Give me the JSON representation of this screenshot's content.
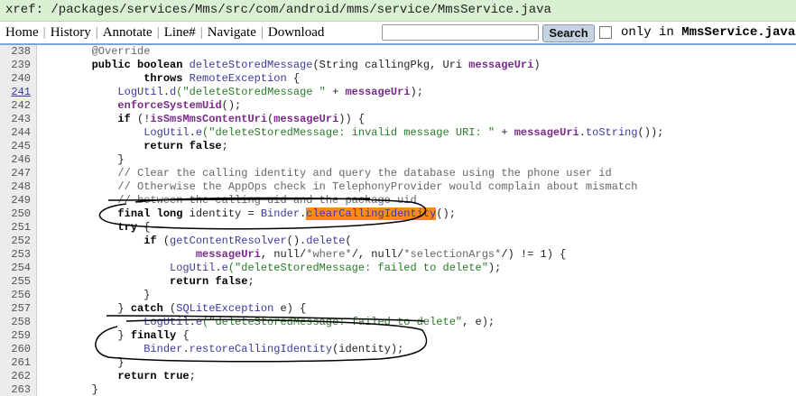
{
  "xref_path": "xref: /packages/services/Mms/src/com/android/mms/service/MmsService.java",
  "nav": {
    "items": [
      "Home",
      "History",
      "Annotate",
      "Line#",
      "Navigate",
      "Download"
    ],
    "search_value": "",
    "search_button": "Search",
    "only_in_prefix": "only in ",
    "only_in_file": "MmsService.java"
  },
  "code": {
    "lines": [
      {
        "n": "238",
        "link": false,
        "t": [
          [
            "cm",
            "        @Override"
          ]
        ]
      },
      {
        "n": "239",
        "link": false,
        "t": [
          [
            "kw",
            "        public boolean "
          ],
          [
            "fn",
            "deleteStoredMessage"
          ],
          [
            "",
            "(String callingPkg, Uri "
          ],
          [
            "id",
            "messageUri"
          ],
          [
            "",
            ")"
          ]
        ]
      },
      {
        "n": "240",
        "link": false,
        "t": [
          [
            "kw",
            "                throws "
          ],
          [
            "ty",
            "RemoteException"
          ],
          [
            "",
            " {"
          ]
        ]
      },
      {
        "n": "241",
        "link": true,
        "t": [
          [
            "",
            "            "
          ],
          [
            "ty",
            "LogUtil"
          ],
          [
            "",
            "."
          ],
          [
            "fn",
            "d"
          ],
          [
            "str",
            "(\"deleteStoredMessage \" "
          ],
          [
            "",
            "+ "
          ],
          [
            "id",
            "messageUri"
          ],
          [
            "",
            ");"
          ]
        ]
      },
      {
        "n": "242",
        "link": false,
        "t": [
          [
            "",
            "            "
          ],
          [
            "id",
            "enforceSystemUid"
          ],
          [
            "",
            "();"
          ]
        ]
      },
      {
        "n": "243",
        "link": false,
        "t": [
          [
            "kw",
            "            if "
          ],
          [
            "",
            "(!"
          ],
          [
            "id",
            "isSmsMmsContentUri"
          ],
          [
            "",
            "("
          ],
          [
            "id",
            "messageUri"
          ],
          [
            "",
            ")) {"
          ]
        ]
      },
      {
        "n": "244",
        "link": false,
        "t": [
          [
            "",
            "                "
          ],
          [
            "ty",
            "LogUtil"
          ],
          [
            "",
            "."
          ],
          [
            "fn",
            "e"
          ],
          [
            "str",
            "(\"deleteStoredMessage: invalid message URI: \" "
          ],
          [
            "",
            "+ "
          ],
          [
            "id",
            "messageUri"
          ],
          [
            "",
            "."
          ],
          [
            "fn",
            "toString"
          ],
          [
            "",
            "());"
          ]
        ]
      },
      {
        "n": "245",
        "link": false,
        "t": [
          [
            "kw",
            "                return false"
          ],
          [
            "",
            ";"
          ]
        ]
      },
      {
        "n": "246",
        "link": false,
        "t": [
          [
            "",
            "            }"
          ]
        ]
      },
      {
        "n": "247",
        "link": false,
        "t": [
          [
            "cm",
            "            // Clear the calling identity and query the database using the phone user id"
          ]
        ]
      },
      {
        "n": "248",
        "link": false,
        "t": [
          [
            "cm",
            "            // Otherwise the AppOps check in TelephonyProvider would complain about mismatch"
          ]
        ]
      },
      {
        "n": "249",
        "link": false,
        "t": [
          [
            "cm",
            "            // between the calling uid and the package uid"
          ]
        ]
      },
      {
        "n": "250",
        "link": false,
        "t": [
          [
            "kw",
            "            final long "
          ],
          [
            "",
            "identity = "
          ],
          [
            "ty",
            "Binder"
          ],
          [
            "",
            "."
          ],
          [
            "hl",
            "clearCallingIdentity"
          ],
          [
            "",
            "();"
          ]
        ]
      },
      {
        "n": "251",
        "link": false,
        "t": [
          [
            "kw",
            "            try "
          ],
          [
            "",
            "{"
          ]
        ]
      },
      {
        "n": "252",
        "link": false,
        "t": [
          [
            "kw",
            "                if "
          ],
          [
            "",
            "("
          ],
          [
            "fn",
            "getContentResolver"
          ],
          [
            "",
            "()."
          ],
          [
            "fn",
            "delete"
          ],
          [
            "",
            "("
          ]
        ]
      },
      {
        "n": "253",
        "link": false,
        "t": [
          [
            "",
            "                        "
          ],
          [
            "id",
            "messageUri"
          ],
          [
            "",
            ", null/"
          ],
          [
            "cm",
            "*where*"
          ],
          [
            "",
            "/, null/"
          ],
          [
            "cm",
            "*selectionArgs*"
          ],
          [
            "",
            "/) != 1) {"
          ]
        ]
      },
      {
        "n": "254",
        "link": false,
        "t": [
          [
            "",
            "                    "
          ],
          [
            "ty",
            "LogUtil"
          ],
          [
            "",
            "."
          ],
          [
            "fn",
            "e"
          ],
          [
            "str",
            "(\"deleteStoredMessage: failed to delete\""
          ],
          [
            "",
            ");"
          ]
        ]
      },
      {
        "n": "255",
        "link": false,
        "t": [
          [
            "kw",
            "                    return false"
          ],
          [
            "",
            ";"
          ]
        ]
      },
      {
        "n": "256",
        "link": false,
        "t": [
          [
            "",
            "                }"
          ]
        ]
      },
      {
        "n": "257",
        "link": false,
        "t": [
          [
            "",
            "            } "
          ],
          [
            "kw",
            "catch "
          ],
          [
            "",
            "("
          ],
          [
            "ty",
            "SQLiteException"
          ],
          [
            "",
            " e) {"
          ]
        ]
      },
      {
        "n": "258",
        "link": false,
        "t": [
          [
            "",
            "                "
          ],
          [
            "ty",
            "LogUtil"
          ],
          [
            "",
            "."
          ],
          [
            "fn",
            "e"
          ],
          [
            "str",
            "(\"deleteStoredMessage: failed to delete\""
          ],
          [
            "",
            ", e);"
          ]
        ]
      },
      {
        "n": "259",
        "link": false,
        "t": [
          [
            "",
            "            } "
          ],
          [
            "kw",
            "finally "
          ],
          [
            "",
            "{"
          ]
        ]
      },
      {
        "n": "260",
        "link": false,
        "t": [
          [
            "",
            "                "
          ],
          [
            "ty",
            "Binder"
          ],
          [
            "",
            "."
          ],
          [
            "fn",
            "restoreCallingIdentity"
          ],
          [
            "",
            "(identity);"
          ]
        ]
      },
      {
        "n": "261",
        "link": false,
        "t": [
          [
            "",
            "            }"
          ]
        ]
      },
      {
        "n": "262",
        "link": false,
        "t": [
          [
            "kw",
            "            return true"
          ],
          [
            "",
            ";"
          ]
        ]
      },
      {
        "n": "263",
        "link": false,
        "t": [
          [
            "",
            "        }"
          ]
        ]
      }
    ]
  }
}
